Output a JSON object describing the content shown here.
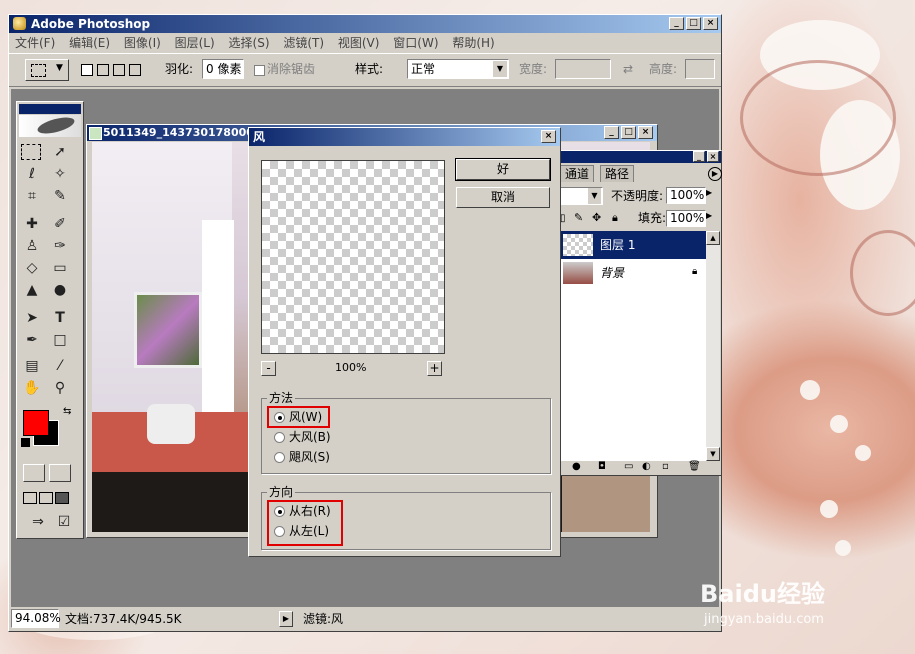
{
  "app": {
    "title": "Adobe Photoshop"
  },
  "menu": [
    "文件(F)",
    "编辑(E)",
    "图像(I)",
    "图层(L)",
    "选择(S)",
    "滤镜(T)",
    "视图(V)",
    "窗口(W)",
    "帮助(H)"
  ],
  "options": {
    "feather_label": "羽化:",
    "feather_value": "0 像素",
    "antialias_label": "消除锯齿",
    "style_label": "样式:",
    "style_value": "正常",
    "width_label": "宽度:",
    "height_label": "高度:"
  },
  "document": {
    "title": "5011349_143730178000_"
  },
  "layers_panel": {
    "tabs": [
      "通道",
      "路径"
    ],
    "opacity_label": "不透明度:",
    "opacity_value": "100%",
    "fill_label": "填充:",
    "fill_value": "100%",
    "layers": [
      {
        "name": "图层 1",
        "selected": true
      },
      {
        "name": "背景",
        "locked": true
      }
    ]
  },
  "dialog": {
    "title": "风",
    "ok_label": "好",
    "cancel_label": "取消",
    "zoom_value": "100%",
    "zoom_out": "-",
    "zoom_in": "+",
    "method": {
      "title": "方法",
      "options": [
        "风(W)",
        "大风(B)",
        "飓风(S)"
      ],
      "selected": 0
    },
    "direction": {
      "title": "方向",
      "options": [
        "从右(R)",
        "从左(L)"
      ],
      "selected": 0
    }
  },
  "status": {
    "zoom": "94.08%",
    "doc": "文档:737.4K/945.5K",
    "filter": "滤镜:风"
  },
  "watermark": {
    "logo": "Baidu经验",
    "url": "jingyan.baidu.com"
  }
}
